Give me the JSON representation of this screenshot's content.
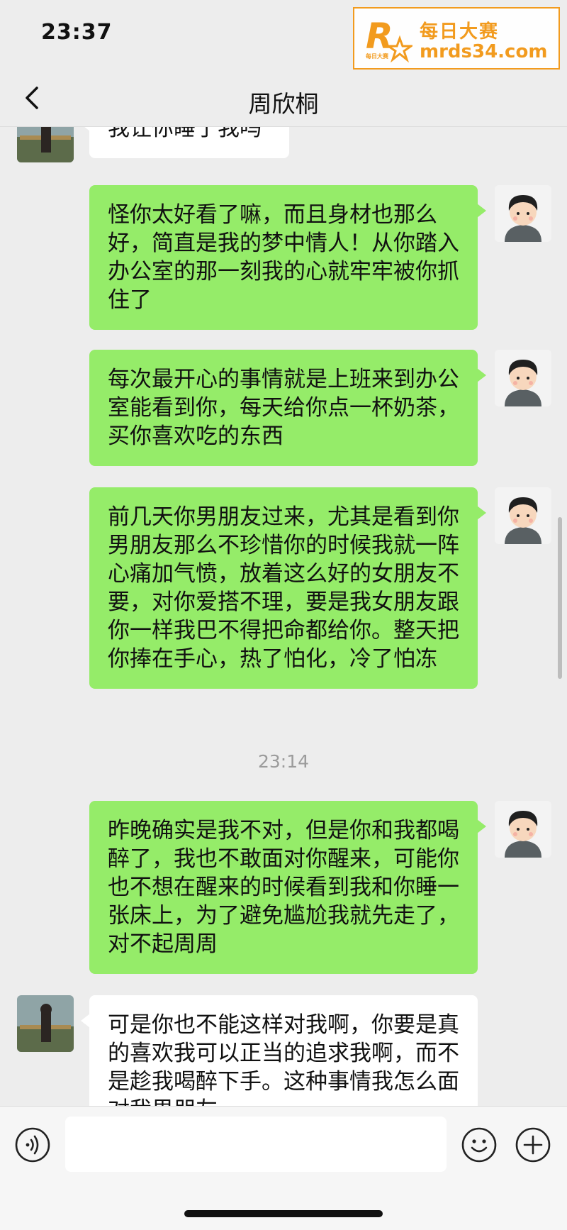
{
  "status_bar": {
    "time": "23:37"
  },
  "watermark": {
    "title": "每日大赛",
    "url": "mrds34.com",
    "logo_letter": "R",
    "logo_small": "每日大赛"
  },
  "nav": {
    "title": "周欣桐",
    "back_icon": "chevron-left-icon"
  },
  "messages": [
    {
      "sender": "other",
      "text": "我让你睡了我吗"
    },
    {
      "sender": "self",
      "text": "怪你太好看了嘛，而且身材也那么好，简直是我的梦中情人！从你踏入办公室的那一刻我的心就牢牢被你抓住了"
    },
    {
      "sender": "self",
      "text": "每次最开心的事情就是上班来到办公室能看到你，每天给你点一杯奶茶，买你喜欢吃的东西"
    },
    {
      "sender": "self",
      "text": "前几天你男朋友过来，尤其是看到你男朋友那么不珍惜你的时候我就一阵心痛加气愤，放着这么好的女朋友不要，对你爱搭不理，要是我女朋友跟你一样我巴不得把命都给你。整天把你捧在手心，热了怕化，冷了怕冻"
    },
    {
      "sender": "self",
      "text": "昨晚确实是我不对，但是你和我都喝醉了，我也不敢面对你醒来，可能你也不想在醒来的时候看到我和你睡一张床上，为了避免尴尬我就先走了，对不起周周"
    },
    {
      "sender": "other",
      "text": "可是你也不能这样对我啊，你要是真的喜欢我可以正当的追求我啊，而不是趁我喝醉下手。这种事情我怎么面对我男朋友"
    }
  ],
  "timestamp": "23:14",
  "input_bar": {
    "placeholder": "",
    "icons": [
      "voice-icon",
      "emoji-icon",
      "plus-icon"
    ]
  },
  "colors": {
    "background": "#ededed",
    "self_bubble": "#95ec69",
    "other_bubble": "#ffffff",
    "watermark": "#f29b1e"
  }
}
